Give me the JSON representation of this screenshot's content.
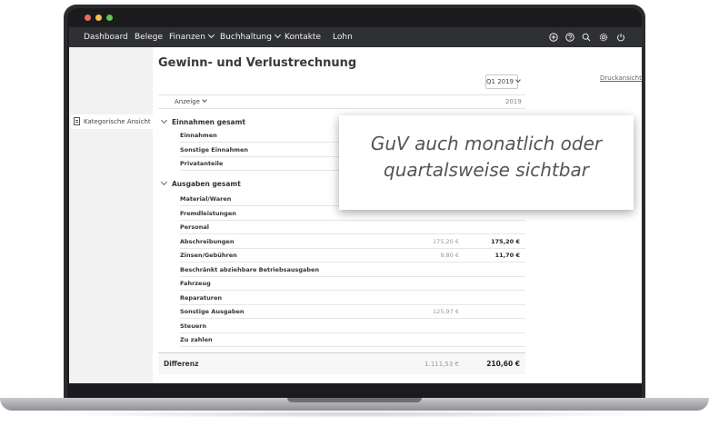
{
  "nav": {
    "items": [
      "Dashboard",
      "Belege",
      "Finanzen",
      "Buchhaltung",
      "Kontakte",
      "Lohn"
    ],
    "icons": [
      "plus-circle-icon",
      "help-icon",
      "search-icon",
      "gear-icon",
      "power-icon"
    ]
  },
  "sidebar": {
    "item": "Kategorische Ansicht"
  },
  "page": {
    "title": "Gewinn- und Verlustrechnung",
    "period": "Q1 2019",
    "print_link": "Druckansicht"
  },
  "table": {
    "anzeige": "Anzeige",
    "year": "2019",
    "income": {
      "title": "Einnahmen gesamt",
      "rows": [
        {
          "label": "Einnahmen",
          "value": "",
          "total": ""
        },
        {
          "label": "Sonstige Einnahmen",
          "value": "",
          "total": ""
        },
        {
          "label": "Privatanteile",
          "value": "",
          "total": ""
        }
      ]
    },
    "expenses": {
      "title": "Ausgaben gesamt",
      "rows": [
        {
          "label": "Material/Waren",
          "value": "",
          "total": ""
        },
        {
          "label": "Fremdleistungen",
          "value": "",
          "total": ""
        },
        {
          "label": "Personal",
          "value": "",
          "total": ""
        },
        {
          "label": "Abschreibungen",
          "value": "175,20 €",
          "total": "175,20 €"
        },
        {
          "label": "Zinsen/Gebühren",
          "value": "9,80 €",
          "total": "11,70 €"
        },
        {
          "label": "Beschränkt abziehbare Betriebsausgaben",
          "value": "",
          "total": ""
        },
        {
          "label": "Fahrzeug",
          "value": "",
          "total": ""
        },
        {
          "label": "Reparaturen",
          "value": "",
          "total": ""
        },
        {
          "label": "Sonstige Ausgaben",
          "value": "125,97 €",
          "total": ""
        },
        {
          "label": "Steuern",
          "value": "",
          "total": ""
        },
        {
          "label": "Zu zahlen",
          "value": "",
          "total": ""
        }
      ]
    },
    "difference": {
      "label": "Differenz",
      "value": "1.111,53 €",
      "total": "210,60 €"
    }
  },
  "callout": {
    "line1": "GuV auch monatlich oder",
    "line2": "quartalsweise sichtbar"
  },
  "colors": {
    "navbar": "#2f3034",
    "bezel": "#2b2b2d",
    "callout_text": "#555555"
  }
}
